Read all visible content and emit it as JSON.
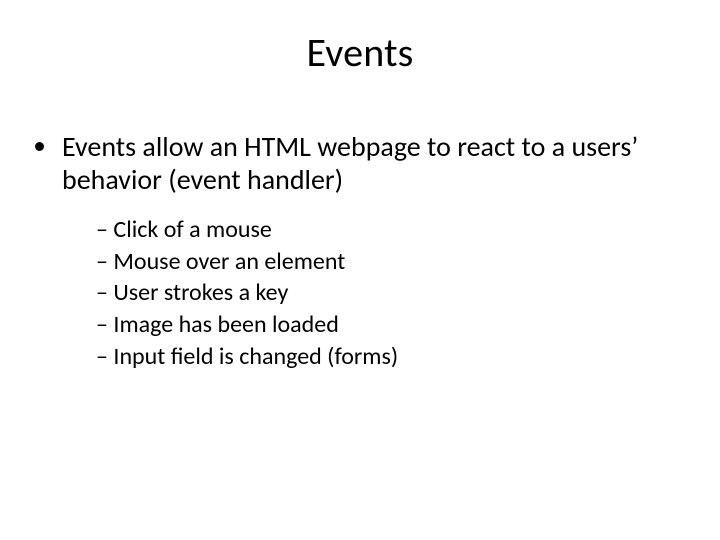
{
  "slide": {
    "title": "Events",
    "bullets": {
      "level1": {
        "item0": "Events allow an HTML webpage to react to a users’ behavior (event handler)"
      },
      "level2": {
        "item0": "Click of a mouse",
        "item1": "Mouse over an element",
        "item2": "User strokes a key",
        "item3": "Image has been loaded",
        "item4": "Input field is changed (forms)"
      }
    }
  }
}
